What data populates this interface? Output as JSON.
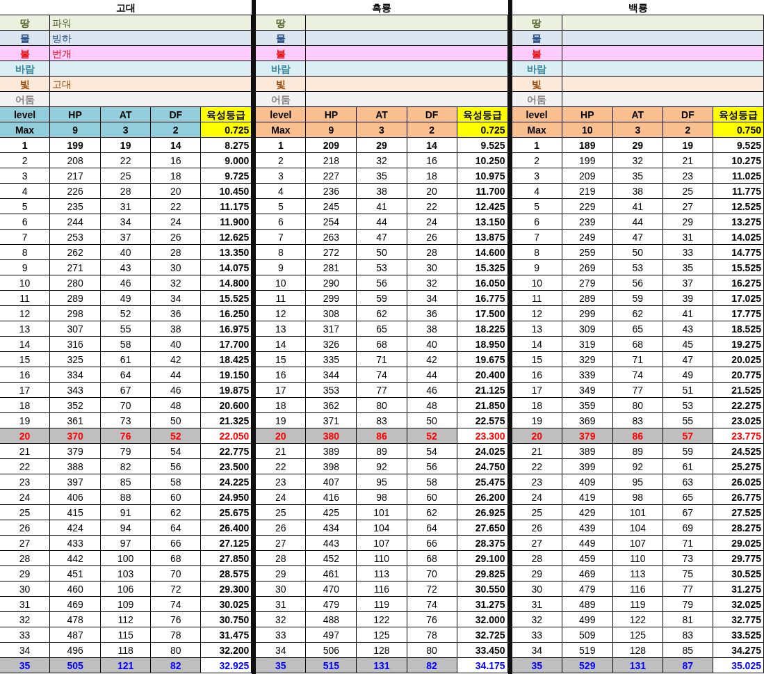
{
  "blocks": [
    {
      "title": "고대",
      "color": "#92cddc",
      "elements": [
        {
          "label": "땅",
          "kind": "earth",
          "value": "파워"
        },
        {
          "label": "물",
          "kind": "water",
          "value": "빙하"
        },
        {
          "label": "불",
          "kind": "fire",
          "value": "번개"
        },
        {
          "label": "바람",
          "kind": "wind"
        },
        {
          "label": "빛",
          "kind": "light",
          "value": "고대"
        },
        {
          "label": "어둠",
          "kind": "dark"
        }
      ],
      "columns": [
        "level",
        "HP",
        "AT",
        "DF",
        "육성등급"
      ],
      "max": [
        "Max",
        "9",
        "3",
        "2",
        "0.725"
      ],
      "rows": [
        {
          "kind": "bold",
          "cells": [
            "1",
            "199",
            "19",
            "14",
            "8.275"
          ]
        },
        {
          "kind": "plain",
          "cells": [
            "2",
            "208",
            "22",
            "16",
            "9.000"
          ]
        },
        {
          "kind": "plain",
          "cells": [
            "3",
            "217",
            "25",
            "18",
            "9.725"
          ]
        },
        {
          "kind": "plain",
          "cells": [
            "4",
            "226",
            "28",
            "20",
            "10.450"
          ]
        },
        {
          "kind": "plain",
          "cells": [
            "5",
            "235",
            "31",
            "22",
            "11.175"
          ]
        },
        {
          "kind": "plain",
          "cells": [
            "6",
            "244",
            "34",
            "24",
            "11.900"
          ]
        },
        {
          "kind": "plain",
          "cells": [
            "7",
            "253",
            "37",
            "26",
            "12.625"
          ]
        },
        {
          "kind": "plain",
          "cells": [
            "8",
            "262",
            "40",
            "28",
            "13.350"
          ]
        },
        {
          "kind": "plain",
          "cells": [
            "9",
            "271",
            "43",
            "30",
            "14.075"
          ]
        },
        {
          "kind": "plain",
          "cells": [
            "10",
            "280",
            "46",
            "32",
            "14.800"
          ]
        },
        {
          "kind": "plain",
          "cells": [
            "11",
            "289",
            "49",
            "34",
            "15.525"
          ]
        },
        {
          "kind": "plain",
          "cells": [
            "12",
            "298",
            "52",
            "36",
            "16.250"
          ]
        },
        {
          "kind": "plain",
          "cells": [
            "13",
            "307",
            "55",
            "38",
            "16.975"
          ]
        },
        {
          "kind": "plain",
          "cells": [
            "14",
            "316",
            "58",
            "40",
            "17.700"
          ]
        },
        {
          "kind": "plain",
          "cells": [
            "15",
            "325",
            "61",
            "42",
            "18.425"
          ]
        },
        {
          "kind": "plain",
          "cells": [
            "16",
            "334",
            "64",
            "44",
            "19.150"
          ]
        },
        {
          "kind": "plain",
          "cells": [
            "17",
            "343",
            "67",
            "46",
            "19.875"
          ]
        },
        {
          "kind": "plain",
          "cells": [
            "18",
            "352",
            "70",
            "48",
            "20.600"
          ]
        },
        {
          "kind": "plain",
          "cells": [
            "19",
            "361",
            "73",
            "50",
            "21.325"
          ]
        },
        {
          "kind": "red",
          "cells": [
            "20",
            "370",
            "76",
            "52",
            "22.050"
          ]
        },
        {
          "kind": "plain",
          "cells": [
            "21",
            "379",
            "79",
            "54",
            "22.775"
          ]
        },
        {
          "kind": "plain",
          "cells": [
            "22",
            "388",
            "82",
            "56",
            "23.500"
          ]
        },
        {
          "kind": "plain",
          "cells": [
            "23",
            "397",
            "85",
            "58",
            "24.225"
          ]
        },
        {
          "kind": "plain",
          "cells": [
            "24",
            "406",
            "88",
            "60",
            "24.950"
          ]
        },
        {
          "kind": "plain",
          "cells": [
            "25",
            "415",
            "91",
            "62",
            "25.675"
          ]
        },
        {
          "kind": "plain",
          "cells": [
            "26",
            "424",
            "94",
            "64",
            "26.400"
          ]
        },
        {
          "kind": "plain",
          "cells": [
            "27",
            "433",
            "97",
            "66",
            "27.125"
          ]
        },
        {
          "kind": "plain",
          "cells": [
            "28",
            "442",
            "100",
            "68",
            "27.850"
          ]
        },
        {
          "kind": "plain",
          "cells": [
            "29",
            "451",
            "103",
            "70",
            "28.575"
          ]
        },
        {
          "kind": "plain",
          "cells": [
            "30",
            "460",
            "106",
            "72",
            "29.300"
          ]
        },
        {
          "kind": "plain",
          "cells": [
            "31",
            "469",
            "109",
            "74",
            "30.025"
          ]
        },
        {
          "kind": "plain",
          "cells": [
            "32",
            "478",
            "112",
            "76",
            "30.750"
          ]
        },
        {
          "kind": "plain",
          "cells": [
            "33",
            "487",
            "115",
            "78",
            "31.475"
          ]
        },
        {
          "kind": "plain",
          "cells": [
            "34",
            "496",
            "118",
            "80",
            "32.200"
          ]
        },
        {
          "kind": "blue",
          "cells": [
            "35",
            "505",
            "121",
            "82",
            "32.925"
          ]
        }
      ]
    },
    {
      "title": "흑룡",
      "color": "#fabf8f",
      "elements": [
        {
          "label": "땅",
          "kind": "earth"
        },
        {
          "label": "물",
          "kind": "water"
        },
        {
          "label": "불",
          "kind": "fire"
        },
        {
          "label": "바람",
          "kind": "wind"
        },
        {
          "label": "빛",
          "kind": "light"
        },
        {
          "label": "어둠",
          "kind": "dark"
        }
      ],
      "columns": [
        "level",
        "HP",
        "AT",
        "DF",
        "육성등급"
      ],
      "max": [
        "Max",
        "9",
        "3",
        "2",
        "0.725"
      ],
      "rows": [
        {
          "kind": "bold",
          "cells": [
            "1",
            "209",
            "29",
            "14",
            "9.525"
          ]
        },
        {
          "kind": "plain",
          "cells": [
            "2",
            "218",
            "32",
            "16",
            "10.250"
          ]
        },
        {
          "kind": "plain",
          "cells": [
            "3",
            "227",
            "35",
            "18",
            "10.975"
          ]
        },
        {
          "kind": "plain",
          "cells": [
            "4",
            "236",
            "38",
            "20",
            "11.700"
          ]
        },
        {
          "kind": "plain",
          "cells": [
            "5",
            "245",
            "41",
            "22",
            "12.425"
          ]
        },
        {
          "kind": "plain",
          "cells": [
            "6",
            "254",
            "44",
            "24",
            "13.150"
          ]
        },
        {
          "kind": "plain",
          "cells": [
            "7",
            "263",
            "47",
            "26",
            "13.875"
          ]
        },
        {
          "kind": "plain",
          "cells": [
            "8",
            "272",
            "50",
            "28",
            "14.600"
          ]
        },
        {
          "kind": "plain",
          "cells": [
            "9",
            "281",
            "53",
            "30",
            "15.325"
          ]
        },
        {
          "kind": "plain",
          "cells": [
            "10",
            "290",
            "56",
            "32",
            "16.050"
          ]
        },
        {
          "kind": "plain",
          "cells": [
            "11",
            "299",
            "59",
            "34",
            "16.775"
          ]
        },
        {
          "kind": "plain",
          "cells": [
            "12",
            "308",
            "62",
            "36",
            "17.500"
          ]
        },
        {
          "kind": "plain",
          "cells": [
            "13",
            "317",
            "65",
            "38",
            "18.225"
          ]
        },
        {
          "kind": "plain",
          "cells": [
            "14",
            "326",
            "68",
            "40",
            "18.950"
          ]
        },
        {
          "kind": "plain",
          "cells": [
            "15",
            "335",
            "71",
            "42",
            "19.675"
          ]
        },
        {
          "kind": "plain",
          "cells": [
            "16",
            "344",
            "74",
            "44",
            "20.400"
          ]
        },
        {
          "kind": "plain",
          "cells": [
            "17",
            "353",
            "77",
            "46",
            "21.125"
          ]
        },
        {
          "kind": "plain",
          "cells": [
            "18",
            "362",
            "80",
            "48",
            "21.850"
          ]
        },
        {
          "kind": "plain",
          "cells": [
            "19",
            "371",
            "83",
            "50",
            "22.575"
          ]
        },
        {
          "kind": "red",
          "cells": [
            "20",
            "380",
            "86",
            "52",
            "23.300"
          ]
        },
        {
          "kind": "plain",
          "cells": [
            "21",
            "389",
            "89",
            "54",
            "24.025"
          ]
        },
        {
          "kind": "plain",
          "cells": [
            "22",
            "398",
            "92",
            "56",
            "24.750"
          ]
        },
        {
          "kind": "plain",
          "cells": [
            "23",
            "407",
            "95",
            "58",
            "25.475"
          ]
        },
        {
          "kind": "plain",
          "cells": [
            "24",
            "416",
            "98",
            "60",
            "26.200"
          ]
        },
        {
          "kind": "plain",
          "cells": [
            "25",
            "425",
            "101",
            "62",
            "26.925"
          ]
        },
        {
          "kind": "plain",
          "cells": [
            "26",
            "434",
            "104",
            "64",
            "27.650"
          ]
        },
        {
          "kind": "plain",
          "cells": [
            "27",
            "443",
            "107",
            "66",
            "28.375"
          ]
        },
        {
          "kind": "plain",
          "cells": [
            "28",
            "452",
            "110",
            "68",
            "29.100"
          ]
        },
        {
          "kind": "plain",
          "cells": [
            "29",
            "461",
            "113",
            "70",
            "29.825"
          ]
        },
        {
          "kind": "plain",
          "cells": [
            "30",
            "470",
            "116",
            "72",
            "30.550"
          ]
        },
        {
          "kind": "plain",
          "cells": [
            "31",
            "479",
            "119",
            "74",
            "31.275"
          ]
        },
        {
          "kind": "plain",
          "cells": [
            "32",
            "488",
            "122",
            "76",
            "32.000"
          ]
        },
        {
          "kind": "plain",
          "cells": [
            "33",
            "497",
            "125",
            "78",
            "32.725"
          ]
        },
        {
          "kind": "plain",
          "cells": [
            "34",
            "506",
            "128",
            "80",
            "33.450"
          ]
        },
        {
          "kind": "blue",
          "cells": [
            "35",
            "515",
            "131",
            "82",
            "34.175"
          ]
        }
      ]
    },
    {
      "title": "백룡",
      "color": "#fabf8f",
      "elements": [
        {
          "label": "땅",
          "kind": "earth"
        },
        {
          "label": "물",
          "kind": "water"
        },
        {
          "label": "불",
          "kind": "fire"
        },
        {
          "label": "바람",
          "kind": "wind"
        },
        {
          "label": "빛",
          "kind": "light"
        },
        {
          "label": "어둠",
          "kind": "dark"
        }
      ],
      "columns": [
        "level",
        "HP",
        "AT",
        "DF",
        "육성등급"
      ],
      "max": [
        "Max",
        "10",
        "3",
        "2",
        "0.750"
      ],
      "rows": [
        {
          "kind": "bold",
          "cells": [
            "1",
            "189",
            "29",
            "19",
            "9.525"
          ]
        },
        {
          "kind": "plain",
          "cells": [
            "2",
            "199",
            "32",
            "21",
            "10.275"
          ]
        },
        {
          "kind": "plain",
          "cells": [
            "3",
            "209",
            "35",
            "23",
            "11.025"
          ]
        },
        {
          "kind": "plain",
          "cells": [
            "4",
            "219",
            "38",
            "25",
            "11.775"
          ]
        },
        {
          "kind": "plain",
          "cells": [
            "5",
            "229",
            "41",
            "27",
            "12.525"
          ]
        },
        {
          "kind": "plain",
          "cells": [
            "6",
            "239",
            "44",
            "29",
            "13.275"
          ]
        },
        {
          "kind": "plain",
          "cells": [
            "7",
            "249",
            "47",
            "31",
            "14.025"
          ]
        },
        {
          "kind": "plain",
          "cells": [
            "8",
            "259",
            "50",
            "33",
            "14.775"
          ]
        },
        {
          "kind": "plain",
          "cells": [
            "9",
            "269",
            "53",
            "35",
            "15.525"
          ]
        },
        {
          "kind": "plain",
          "cells": [
            "10",
            "279",
            "56",
            "37",
            "16.275"
          ]
        },
        {
          "kind": "plain",
          "cells": [
            "11",
            "289",
            "59",
            "39",
            "17.025"
          ]
        },
        {
          "kind": "plain",
          "cells": [
            "12",
            "299",
            "62",
            "41",
            "17.775"
          ]
        },
        {
          "kind": "plain",
          "cells": [
            "13",
            "309",
            "65",
            "43",
            "18.525"
          ]
        },
        {
          "kind": "plain",
          "cells": [
            "14",
            "319",
            "68",
            "45",
            "19.275"
          ]
        },
        {
          "kind": "plain",
          "cells": [
            "15",
            "329",
            "71",
            "47",
            "20.025"
          ]
        },
        {
          "kind": "plain",
          "cells": [
            "16",
            "339",
            "74",
            "49",
            "20.775"
          ]
        },
        {
          "kind": "plain",
          "cells": [
            "17",
            "349",
            "77",
            "51",
            "21.525"
          ]
        },
        {
          "kind": "plain",
          "cells": [
            "18",
            "359",
            "80",
            "53",
            "22.275"
          ]
        },
        {
          "kind": "plain",
          "cells": [
            "19",
            "369",
            "83",
            "55",
            "23.025"
          ]
        },
        {
          "kind": "red",
          "cells": [
            "20",
            "379",
            "86",
            "57",
            "23.775"
          ]
        },
        {
          "kind": "plain",
          "cells": [
            "21",
            "389",
            "89",
            "59",
            "24.525"
          ]
        },
        {
          "kind": "plain",
          "cells": [
            "22",
            "399",
            "92",
            "61",
            "25.275"
          ]
        },
        {
          "kind": "plain",
          "cells": [
            "23",
            "409",
            "95",
            "63",
            "26.025"
          ]
        },
        {
          "kind": "plain",
          "cells": [
            "24",
            "419",
            "98",
            "65",
            "26.775"
          ]
        },
        {
          "kind": "plain",
          "cells": [
            "25",
            "429",
            "101",
            "67",
            "27.525"
          ]
        },
        {
          "kind": "plain",
          "cells": [
            "26",
            "439",
            "104",
            "69",
            "28.275"
          ]
        },
        {
          "kind": "plain",
          "cells": [
            "27",
            "449",
            "107",
            "71",
            "29.025"
          ]
        },
        {
          "kind": "plain",
          "cells": [
            "28",
            "459",
            "110",
            "73",
            "29.775"
          ]
        },
        {
          "kind": "plain",
          "cells": [
            "29",
            "469",
            "113",
            "75",
            "30.525"
          ]
        },
        {
          "kind": "plain",
          "cells": [
            "30",
            "479",
            "116",
            "77",
            "31.275"
          ]
        },
        {
          "kind": "plain",
          "cells": [
            "31",
            "489",
            "119",
            "79",
            "32.025"
          ]
        },
        {
          "kind": "plain",
          "cells": [
            "32",
            "499",
            "122",
            "81",
            "32.775"
          ]
        },
        {
          "kind": "plain",
          "cells": [
            "33",
            "509",
            "125",
            "83",
            "33.525"
          ]
        },
        {
          "kind": "plain",
          "cells": [
            "34",
            "519",
            "128",
            "85",
            "34.275"
          ]
        },
        {
          "kind": "blue",
          "cells": [
            "35",
            "529",
            "131",
            "87",
            "35.025"
          ]
        }
      ]
    }
  ]
}
